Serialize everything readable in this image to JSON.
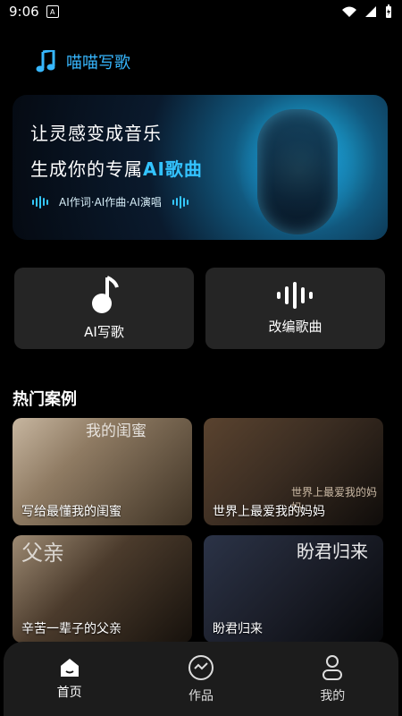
{
  "status_bar": {
    "time": "9:06"
  },
  "app": {
    "name": "喵喵写歌",
    "brand_color": "#37b7ff"
  },
  "banner": {
    "line1": "让灵感变成音乐",
    "line2_prefix": "生成你的专属",
    "line2_ai": "AI歌曲",
    "tags": "AI作词·AI作曲·AI演唱"
  },
  "actions": [
    {
      "label": "AI写歌",
      "icon": "music-note-icon"
    },
    {
      "label": "改编歌曲",
      "icon": "sound-wave-icon"
    }
  ],
  "section": {
    "title": "热门案例"
  },
  "cases": [
    {
      "title": "写给最懂我的闺蜜",
      "poster_text": "我的闺蜜"
    },
    {
      "title": "世界上最爱我的妈妈",
      "poster_text": "世界上最爱我的妈妈"
    },
    {
      "title": "辛苦一辈子的父亲",
      "poster_text": "父亲"
    },
    {
      "title": "盼君归来",
      "poster_text": "盼君归来"
    }
  ],
  "tabs": [
    {
      "label": "首页",
      "icon": "home-icon"
    },
    {
      "label": "作品",
      "icon": "works-icon"
    },
    {
      "label": "我的",
      "icon": "profile-icon"
    }
  ]
}
